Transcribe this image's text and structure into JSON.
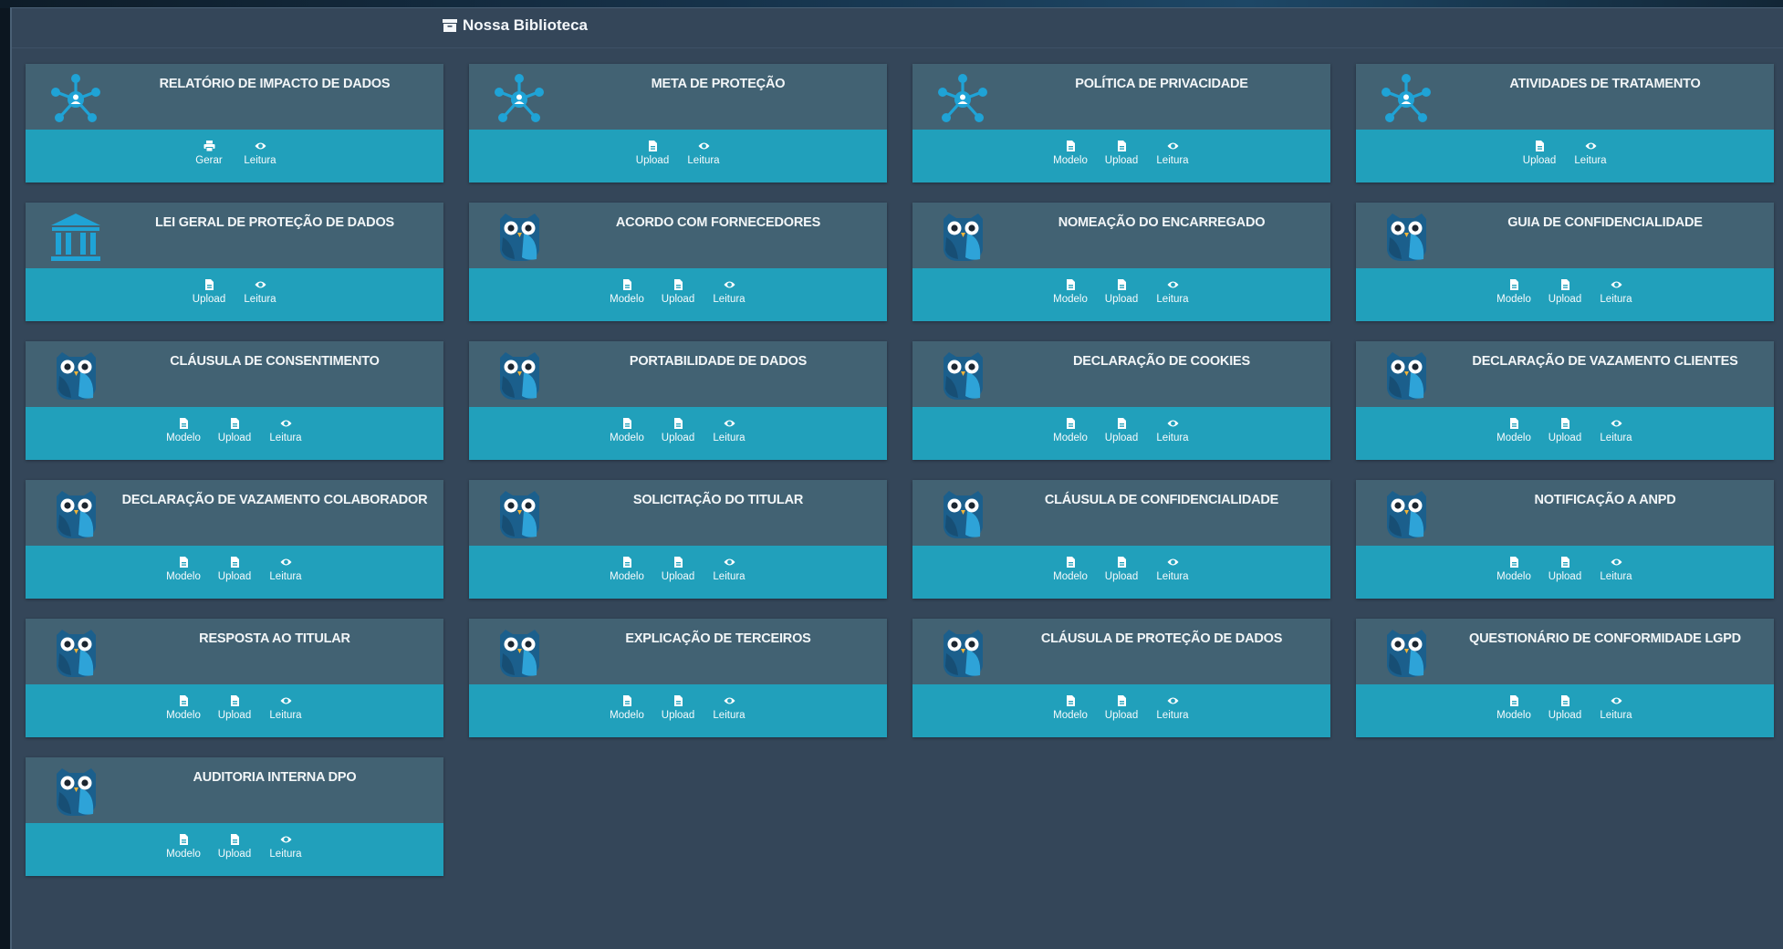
{
  "header": {
    "title": "Nossa Biblioteca",
    "icon": "archive-icon"
  },
  "colors": {
    "panel": "#344659",
    "card_top": "#426273",
    "card_bottom": "#21a0bb",
    "icon_blue": "#1fa3d6"
  },
  "cards": [
    {
      "title": "RELATÓRIO DE IMPACTO DE DADOS",
      "icon": "network-icon",
      "actions": [
        {
          "label": "Gerar",
          "icon": "printer-icon"
        },
        {
          "label": "Leitura",
          "icon": "eye-icon"
        }
      ]
    },
    {
      "title": "META DE PROTEÇÃO",
      "icon": "network-icon",
      "actions": [
        {
          "label": "Upload",
          "icon": "file-icon"
        },
        {
          "label": "Leitura",
          "icon": "eye-icon"
        }
      ]
    },
    {
      "title": "POLÍTICA DE PRIVACIDADE",
      "icon": "network-icon",
      "actions": [
        {
          "label": "Modelo",
          "icon": "file-icon"
        },
        {
          "label": "Upload",
          "icon": "file-icon"
        },
        {
          "label": "Leitura",
          "icon": "eye-icon"
        }
      ]
    },
    {
      "title": "ATIVIDADES DE TRATAMENTO",
      "icon": "network-icon",
      "actions": [
        {
          "label": "Upload",
          "icon": "file-icon"
        },
        {
          "label": "Leitura",
          "icon": "eye-icon"
        }
      ]
    },
    {
      "title": "LEI GERAL DE PROTEÇÃO DE DADOS",
      "icon": "institution-icon",
      "actions": [
        {
          "label": "Upload",
          "icon": "file-icon"
        },
        {
          "label": "Leitura",
          "icon": "eye-icon"
        }
      ]
    },
    {
      "title": "ACORDO COM FORNECEDORES",
      "icon": "owl-icon",
      "actions": [
        {
          "label": "Modelo",
          "icon": "file-icon"
        },
        {
          "label": "Upload",
          "icon": "file-icon"
        },
        {
          "label": "Leitura",
          "icon": "eye-icon"
        }
      ]
    },
    {
      "title": "NOMEAÇÃO DO ENCARREGADO",
      "icon": "owl-icon",
      "actions": [
        {
          "label": "Modelo",
          "icon": "file-icon"
        },
        {
          "label": "Upload",
          "icon": "file-icon"
        },
        {
          "label": "Leitura",
          "icon": "eye-icon"
        }
      ]
    },
    {
      "title": "GUIA DE CONFIDENCIALIDADE",
      "icon": "owl-icon",
      "actions": [
        {
          "label": "Modelo",
          "icon": "file-icon"
        },
        {
          "label": "Upload",
          "icon": "file-icon"
        },
        {
          "label": "Leitura",
          "icon": "eye-icon"
        }
      ]
    },
    {
      "title": "CLÁUSULA DE CONSENTIMENTO",
      "icon": "owl-icon",
      "actions": [
        {
          "label": "Modelo",
          "icon": "file-icon"
        },
        {
          "label": "Upload",
          "icon": "file-icon"
        },
        {
          "label": "Leitura",
          "icon": "eye-icon"
        }
      ]
    },
    {
      "title": "PORTABILIDADE DE DADOS",
      "icon": "owl-icon",
      "actions": [
        {
          "label": "Modelo",
          "icon": "file-icon"
        },
        {
          "label": "Upload",
          "icon": "file-icon"
        },
        {
          "label": "Leitura",
          "icon": "eye-icon"
        }
      ]
    },
    {
      "title": "DECLARAÇÃO DE COOKIES",
      "icon": "owl-icon",
      "actions": [
        {
          "label": "Modelo",
          "icon": "file-icon"
        },
        {
          "label": "Upload",
          "icon": "file-icon"
        },
        {
          "label": "Leitura",
          "icon": "eye-icon"
        }
      ]
    },
    {
      "title": "DECLARAÇÃO DE VAZAMENTO CLIENTES",
      "icon": "owl-icon",
      "actions": [
        {
          "label": "Modelo",
          "icon": "file-icon"
        },
        {
          "label": "Upload",
          "icon": "file-icon"
        },
        {
          "label": "Leitura",
          "icon": "eye-icon"
        }
      ]
    },
    {
      "title": "DECLARAÇÃO DE VAZAMENTO COLABORADOR",
      "icon": "owl-icon",
      "actions": [
        {
          "label": "Modelo",
          "icon": "file-icon"
        },
        {
          "label": "Upload",
          "icon": "file-icon"
        },
        {
          "label": "Leitura",
          "icon": "eye-icon"
        }
      ]
    },
    {
      "title": "SOLICITAÇÃO DO TITULAR",
      "icon": "owl-icon",
      "actions": [
        {
          "label": "Modelo",
          "icon": "file-icon"
        },
        {
          "label": "Upload",
          "icon": "file-icon"
        },
        {
          "label": "Leitura",
          "icon": "eye-icon"
        }
      ]
    },
    {
      "title": "CLÁUSULA DE CONFIDENCIALIDADE",
      "icon": "owl-icon",
      "actions": [
        {
          "label": "Modelo",
          "icon": "file-icon"
        },
        {
          "label": "Upload",
          "icon": "file-icon"
        },
        {
          "label": "Leitura",
          "icon": "eye-icon"
        }
      ]
    },
    {
      "title": "NOTIFICAÇÃO A ANPD",
      "icon": "owl-icon",
      "actions": [
        {
          "label": "Modelo",
          "icon": "file-icon"
        },
        {
          "label": "Upload",
          "icon": "file-icon"
        },
        {
          "label": "Leitura",
          "icon": "eye-icon"
        }
      ]
    },
    {
      "title": "RESPOSTA AO TITULAR",
      "icon": "owl-icon",
      "actions": [
        {
          "label": "Modelo",
          "icon": "file-icon"
        },
        {
          "label": "Upload",
          "icon": "file-icon"
        },
        {
          "label": "Leitura",
          "icon": "eye-icon"
        }
      ]
    },
    {
      "title": "EXPLICAÇÃO DE TERCEIROS",
      "icon": "owl-icon",
      "actions": [
        {
          "label": "Modelo",
          "icon": "file-icon"
        },
        {
          "label": "Upload",
          "icon": "file-icon"
        },
        {
          "label": "Leitura",
          "icon": "eye-icon"
        }
      ]
    },
    {
      "title": "CLÁUSULA DE PROTEÇÃO DE DADOS",
      "icon": "owl-icon",
      "actions": [
        {
          "label": "Modelo",
          "icon": "file-icon"
        },
        {
          "label": "Upload",
          "icon": "file-icon"
        },
        {
          "label": "Leitura",
          "icon": "eye-icon"
        }
      ]
    },
    {
      "title": "QUESTIONÁRIO DE CONFORMIDADE LGPD",
      "icon": "owl-icon",
      "actions": [
        {
          "label": "Modelo",
          "icon": "file-icon"
        },
        {
          "label": "Upload",
          "icon": "file-icon"
        },
        {
          "label": "Leitura",
          "icon": "eye-icon"
        }
      ]
    },
    {
      "title": "AUDITORIA INTERNA DPO",
      "icon": "owl-icon",
      "actions": [
        {
          "label": "Modelo",
          "icon": "file-icon"
        },
        {
          "label": "Upload",
          "icon": "file-icon"
        },
        {
          "label": "Leitura",
          "icon": "eye-icon"
        }
      ]
    }
  ]
}
